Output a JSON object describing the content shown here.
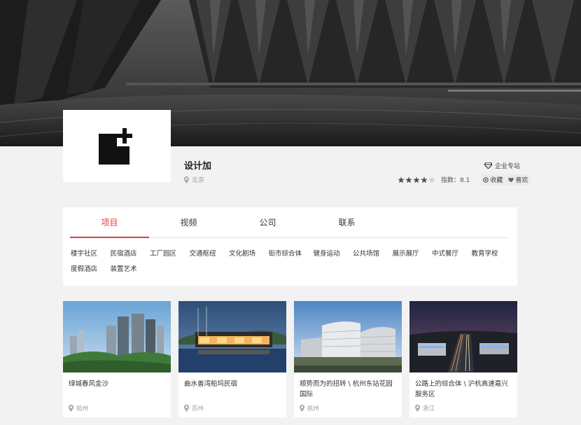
{
  "company": {
    "name": "设计加",
    "location": "北京",
    "badge_label": "企业专站",
    "rating_stars": 4,
    "rating_max": 5,
    "score_text": "指数：8.1",
    "favorite_label": "收藏",
    "like_label": "喜欢"
  },
  "tabs": [
    {
      "label": "项目",
      "active": true
    },
    {
      "label": "视频",
      "active": false
    },
    {
      "label": "公司",
      "active": false
    },
    {
      "label": "联系",
      "active": false
    }
  ],
  "categories": [
    "楼宇社区",
    "民宿酒店",
    "工厂园区",
    "交通枢纽",
    "文化剧场",
    "街市综合体",
    "健身运动",
    "公共场馆",
    "展示展厅",
    "中式餐厅",
    "教育学校",
    "度假酒店",
    "装置艺术"
  ],
  "projects": [
    {
      "title": "绿城春风金沙",
      "location": "杭州"
    },
    {
      "title": "曲水善湾船坞民宿",
      "location": "苏州"
    },
    {
      "title": "顺势而为的扭转 \\ 杭州东站花园国际",
      "location": "杭州"
    },
    {
      "title": "公路上的综合体 \\ 沪杭高速嘉兴服务区",
      "location": "浙江"
    }
  ],
  "colors": {
    "accent": "#e4393c",
    "star": "#555555"
  }
}
